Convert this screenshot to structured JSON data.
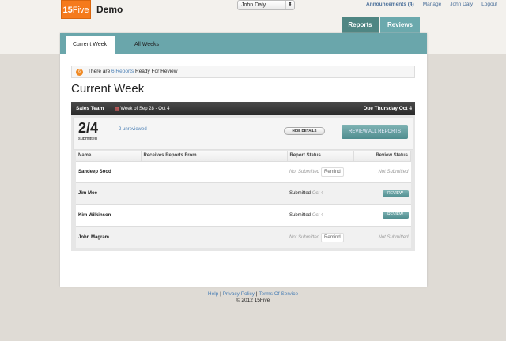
{
  "header": {
    "logo": {
      "num": "15",
      "word": "Five"
    },
    "app_name": "Demo",
    "user_select": "John Daly",
    "links": [
      "Announcements (4)",
      "Manage",
      "John Daly",
      "Logout"
    ],
    "main_tabs": [
      "Reports",
      "Reviews"
    ]
  },
  "subtabs": [
    "Current Week",
    "All Weeks"
  ],
  "notice": {
    "badge": "6",
    "pre": "There are ",
    "link": "6 Reports",
    "post": " Ready For Review"
  },
  "page_title": "Current Week",
  "team": {
    "name": "Sales Team",
    "week": "Week of Sep 28 - Oct 4",
    "due": "Due Thursday Oct 4",
    "submitted": "2/4",
    "submitted_label": "submitted",
    "unreviewed": "2 unreviewed",
    "hide_details": "HIDE DETAILS",
    "review_all": "REVIEW ALL REPORTS"
  },
  "table": {
    "headers": [
      "Name",
      "Receives Reports From",
      "Report Status",
      "Review Status"
    ],
    "rows": [
      {
        "name": "Sandeep Sood",
        "status": "Not Submitted",
        "action": "Remind",
        "review": "Not Submitted"
      },
      {
        "name": "Jim Moe",
        "status": "Submitted",
        "date": "Oct 4",
        "review": "REVIEW"
      },
      {
        "name": "Kim Wilkinson",
        "status": "Submitted",
        "date": "Oct 4",
        "review": "REVIEW"
      },
      {
        "name": "John Magram",
        "status": "Not Submitted",
        "action": "Remind",
        "review": "Not Submitted"
      }
    ]
  },
  "footer": {
    "links": [
      "Help",
      "Privacy Policy",
      "Terms Of Service"
    ],
    "sep": " | ",
    "copyright": "© 2012 15Five"
  }
}
